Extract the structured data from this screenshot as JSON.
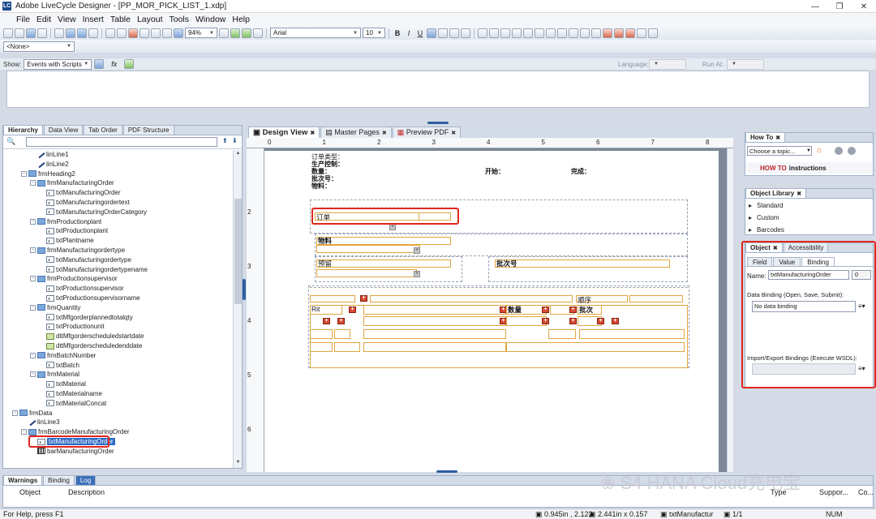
{
  "window": {
    "title": "Adobe LiveCycle Designer - [PP_MOR_PICK_LIST_1.xdp]",
    "app_icon": "LC"
  },
  "menu": [
    "File",
    "Edit",
    "View",
    "Insert",
    "Table",
    "Layout",
    "Tools",
    "Window",
    "Help"
  ],
  "toolbar": {
    "zoom": "94%",
    "font_name": "Arial",
    "font_size": "10",
    "bold": "B",
    "italic": "I",
    "underline": "U"
  },
  "toolbar2": {
    "none_select": "<None>"
  },
  "script_bar": {
    "show_label": "Show:",
    "show_value": "Events with Scripts",
    "fx": "fx",
    "language_label": "Language:",
    "run_at_label": "Run At:"
  },
  "hierarchy": {
    "tabs": [
      "Hierarchy",
      "Data View",
      "Tab Order",
      "PDF Structure"
    ],
    "nodes": [
      {
        "label": "linLine1",
        "type": "line",
        "depth": 3
      },
      {
        "label": "linLine2",
        "type": "line",
        "depth": 3
      },
      {
        "label": "frmHeading2",
        "type": "sub",
        "depth": 2,
        "pm": "-"
      },
      {
        "label": "frmManufacturingOrder",
        "type": "sub",
        "depth": 3,
        "pm": "-"
      },
      {
        "label": "txtManufacturingOrder",
        "type": "txt",
        "depth": 4
      },
      {
        "label": "txtManufacturingordertext",
        "type": "txt",
        "depth": 4
      },
      {
        "label": "txtManufacturingOrderCategory",
        "type": "txt",
        "depth": 4
      },
      {
        "label": "frmProductionplant",
        "type": "sub",
        "depth": 3,
        "pm": "-"
      },
      {
        "label": "txtProductionplant",
        "type": "txt",
        "depth": 4
      },
      {
        "label": "txtPlantname",
        "type": "txt",
        "depth": 4
      },
      {
        "label": "frmManufacturingordertype",
        "type": "sub",
        "depth": 3,
        "pm": "-"
      },
      {
        "label": "txtManufacturingordertype",
        "type": "txt",
        "depth": 4
      },
      {
        "label": "txtManufacturingordertypename",
        "type": "txt",
        "depth": 4
      },
      {
        "label": "frmProductionsupervisor",
        "type": "sub",
        "depth": 3,
        "pm": "-"
      },
      {
        "label": "txtProductionsupervisor",
        "type": "txt",
        "depth": 4
      },
      {
        "label": "txtProductionsupervisorname",
        "type": "txt",
        "depth": 4
      },
      {
        "label": "frmQuantity",
        "type": "sub",
        "depth": 3,
        "pm": "-"
      },
      {
        "label": "txtMfgorderplannedtotalqty",
        "type": "txt",
        "depth": 4
      },
      {
        "label": "txtProductionunit",
        "type": "txt",
        "depth": 4
      },
      {
        "label": "dttMfgorderscheduledstartdate",
        "type": "date",
        "depth": 4
      },
      {
        "label": "dttMfgorderscheduledenddate",
        "type": "date",
        "depth": 4
      },
      {
        "label": "frmBatchNumber",
        "type": "sub",
        "depth": 3,
        "pm": "-"
      },
      {
        "label": "txtBatch",
        "type": "txt",
        "depth": 4
      },
      {
        "label": "frmMaterial",
        "type": "sub",
        "depth": 3,
        "pm": "-"
      },
      {
        "label": "txtMaterial",
        "type": "txt",
        "depth": 4
      },
      {
        "label": "txtMaterialname",
        "type": "txt",
        "depth": 4
      },
      {
        "label": "txtMaterialConcat",
        "type": "txt",
        "depth": 4
      },
      {
        "label": "frmData",
        "type": "sub",
        "depth": 1,
        "pm": "-"
      },
      {
        "label": "linLine3",
        "type": "line",
        "depth": 2
      },
      {
        "label": "frmBarcodeManufacturingOrder",
        "type": "sub",
        "depth": 2,
        "pm": "-"
      },
      {
        "label": "txtManufacturingOrder",
        "type": "txt",
        "depth": 3,
        "selected": true
      },
      {
        "label": "barManufacturingOrder",
        "type": "bar",
        "depth": 3
      }
    ]
  },
  "design": {
    "tabs": [
      "Design View",
      "Master Pages",
      "Preview PDF"
    ],
    "ruler_h": [
      "0",
      "1",
      "2",
      "3",
      "4",
      "5",
      "6",
      "7",
      "8"
    ],
    "ruler_v": [
      "2",
      "3",
      "4",
      "5",
      "6"
    ],
    "header_labels": [
      "订单类型：",
      "生产控制：",
      "数量：",
      "批次号：",
      "物料："
    ],
    "start_label": "开始：",
    "finish_label": "完成：",
    "order_label": "订单",
    "material_label": "物料",
    "reserve_label": "预留",
    "batch_label": "批次号",
    "sequence_label": "顺序",
    "rit_label": "Rit",
    "qty_label": "数量",
    "batch2_label": "批次"
  },
  "right": {
    "howto": {
      "tab": "How To",
      "choose": "Choose a topic...",
      "instructions_prefix": "HOW TO",
      "instructions": "instructions"
    },
    "library": {
      "tab": "Object Library",
      "items": [
        "Standard",
        "Custom",
        "Barcodes"
      ]
    },
    "object": {
      "tabs": [
        "Object",
        "Accessibility"
      ],
      "subtabs": [
        "Field",
        "Value",
        "Binding"
      ],
      "name_label": "Name:",
      "name_value": "txtManufacturingOrder",
      "index_value": "0",
      "data_binding_label": "Data Binding (Open, Save, Submit):",
      "data_binding_value": "No data binding",
      "import_export_label": "Import/Export Bindings (Execute WSDL):"
    }
  },
  "bottom": {
    "tabs": [
      "Warnings",
      "Binding",
      "Log"
    ],
    "cols": [
      "Object",
      "Description",
      "Type",
      "Suppor...",
      "Co..."
    ]
  },
  "status": {
    "help": "For Help, press F1",
    "pos": "0.945in , 2.122",
    "size": "2.441in x 0.157",
    "field": "txtManufactur",
    "page": "1/1",
    "num": "NUM"
  },
  "watermark": "S4 HANA Cloud充电宝"
}
